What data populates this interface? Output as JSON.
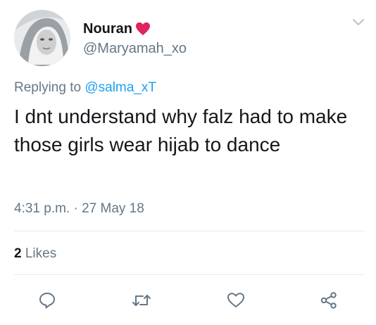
{
  "user": {
    "display_name": "Nouran",
    "handle": "@Maryamah_xo"
  },
  "reply": {
    "prefix": "Replying to",
    "mention": "@salma_xT"
  },
  "tweet": {
    "text": "I dnt understand why falz had to make those girls wear hijab to dance",
    "timestamp": "4:31 p.m. · 27 May 18"
  },
  "stats": {
    "likes_count": "2",
    "likes_label": "Likes"
  },
  "icons": {
    "name_emoji": "heart-icon",
    "menu": "chevron-down-icon",
    "reply": "reply-icon",
    "retweet": "retweet-icon",
    "like": "like-icon",
    "share": "share-icon"
  },
  "colors": {
    "text": "#14171a",
    "secondary": "#657786",
    "link": "#1da1f2",
    "heart": "#e0245e",
    "divider": "#e6ecf0"
  }
}
